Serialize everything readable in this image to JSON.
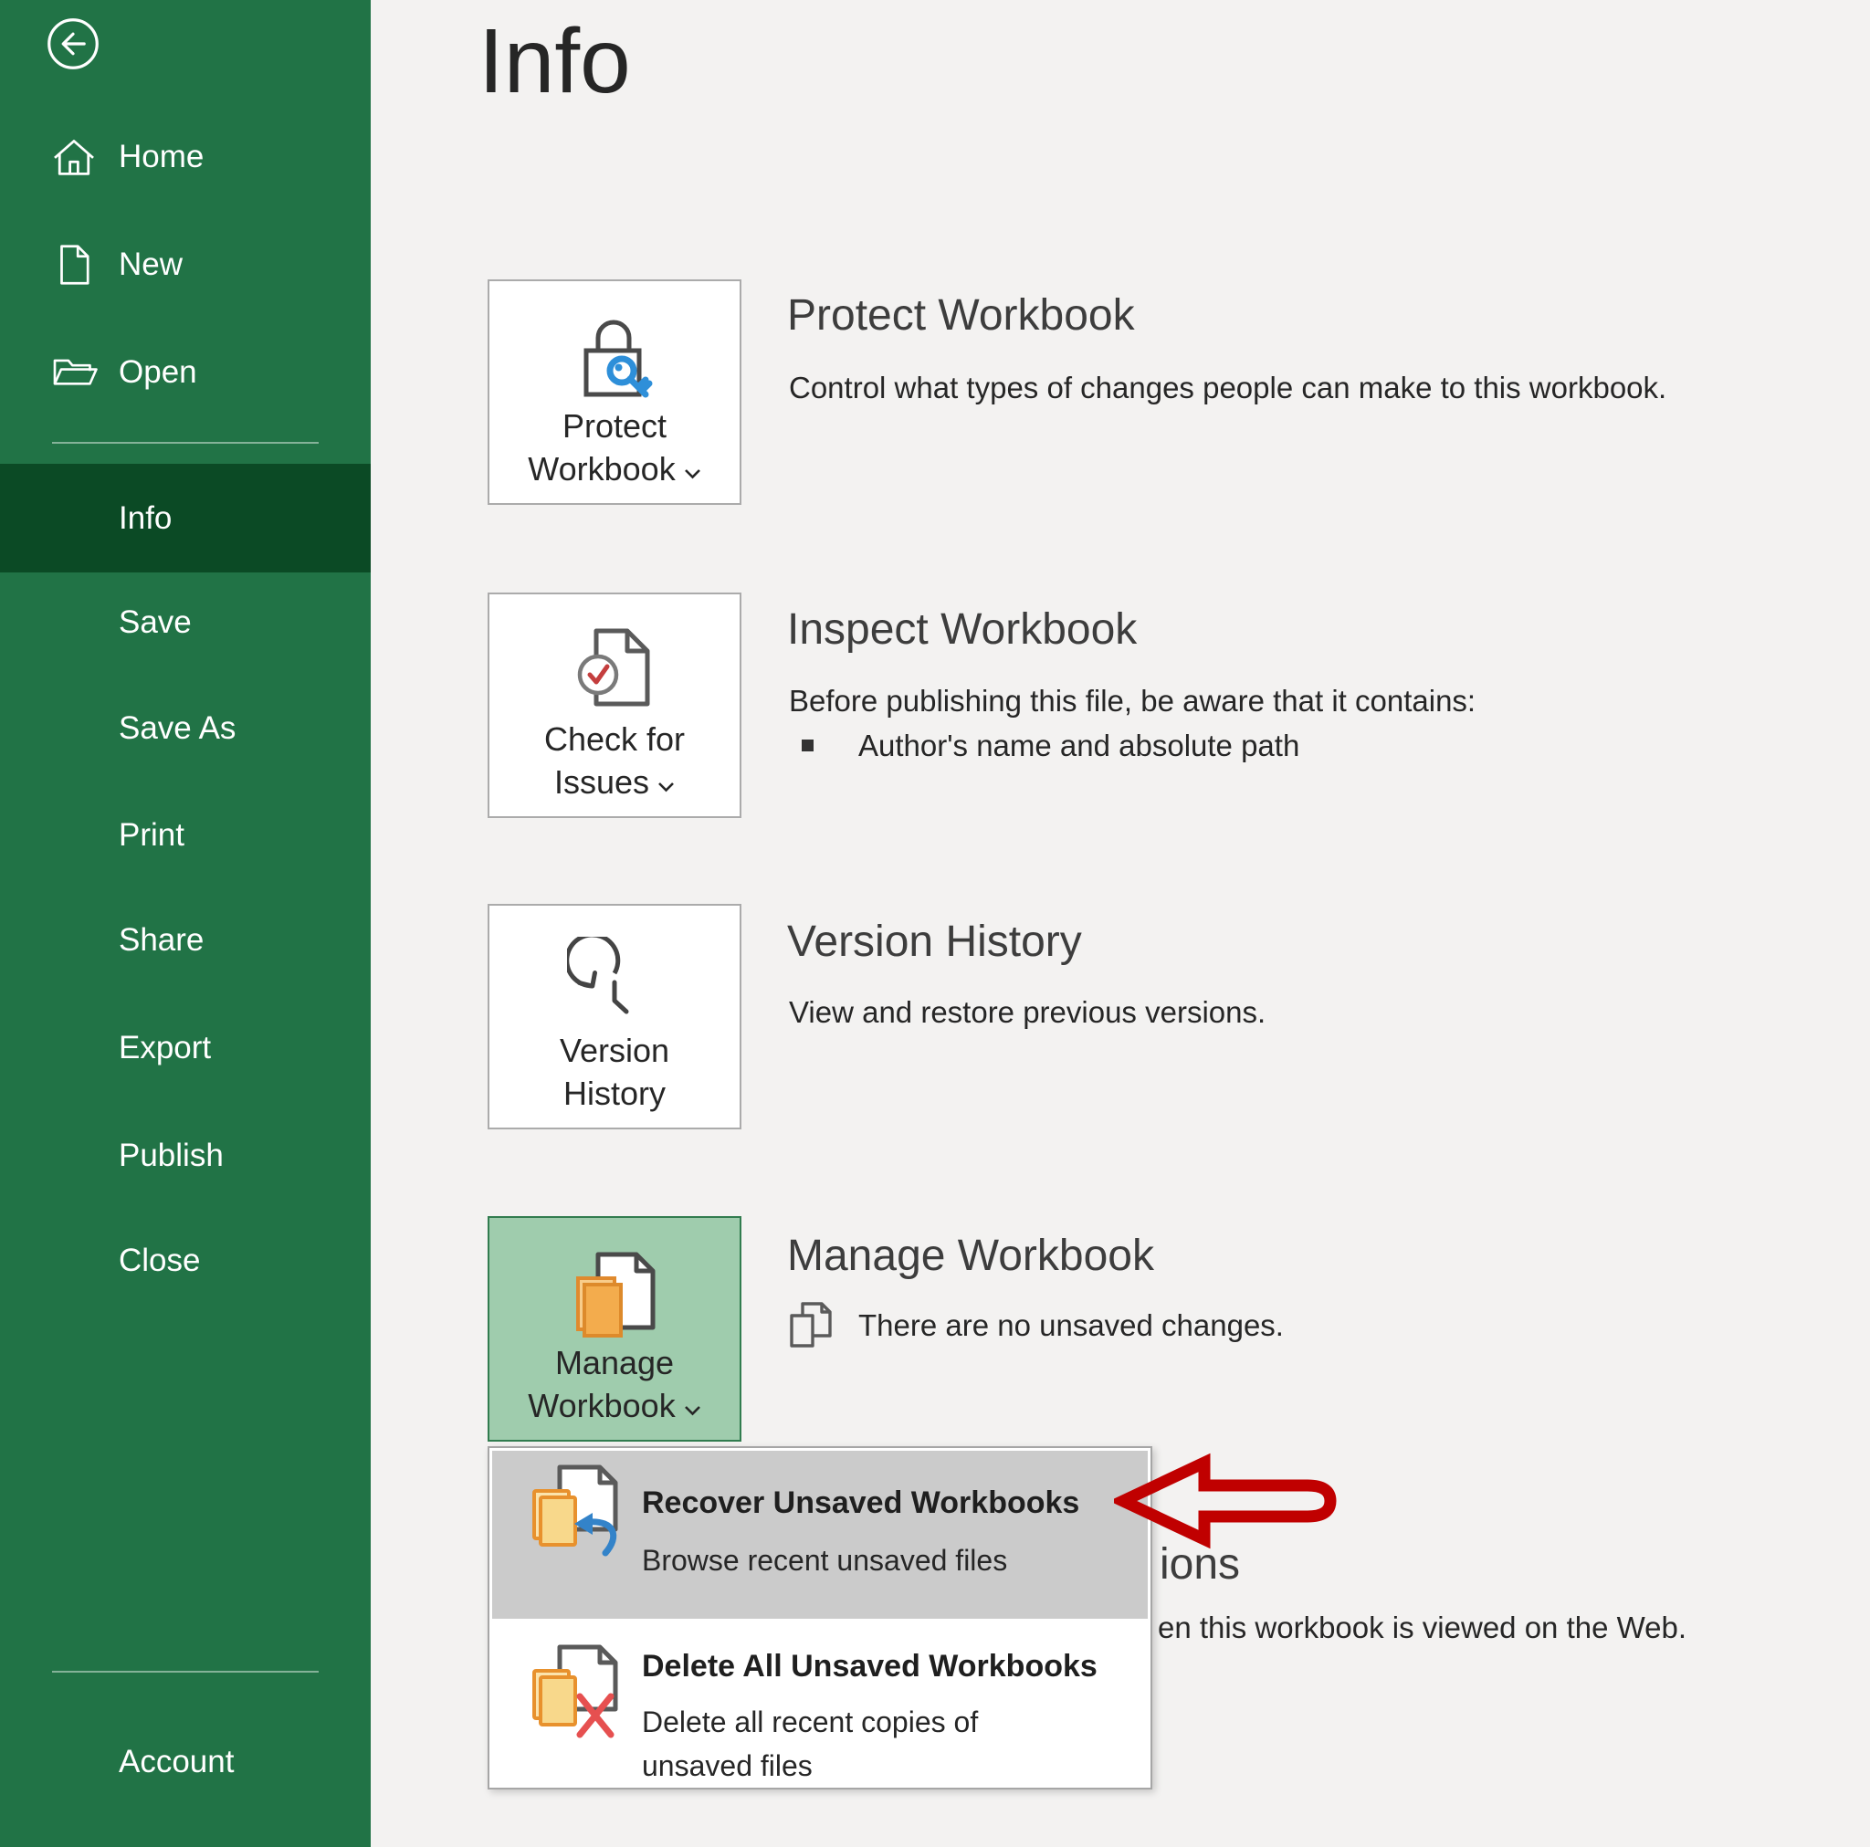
{
  "sidebar": {
    "nav": [
      {
        "label": "Home"
      },
      {
        "label": "New"
      },
      {
        "label": "Open"
      }
    ],
    "menu": [
      {
        "label": "Info",
        "selected": true
      },
      {
        "label": "Save"
      },
      {
        "label": "Save As"
      },
      {
        "label": "Print"
      },
      {
        "label": "Share"
      },
      {
        "label": "Export"
      },
      {
        "label": "Publish"
      },
      {
        "label": "Close"
      }
    ],
    "account": {
      "label": "Account"
    },
    "colors": {
      "background": "#217346",
      "selected_item": "#0b4a25",
      "text": "#ffffff"
    }
  },
  "main": {
    "title": "Info",
    "sections": {
      "protect": {
        "card_label_line1": "Protect",
        "card_label_line2": "Workbook",
        "heading": "Protect Workbook",
        "description": "Control what types of changes people can make to this workbook."
      },
      "inspect": {
        "card_label_line1": "Check for",
        "card_label_line2": "Issues",
        "heading": "Inspect Workbook",
        "description": "Before publishing this file, be aware that it contains:",
        "bullet": "Author's name and absolute path"
      },
      "version": {
        "card_label_line1": "Version",
        "card_label_line2": "History",
        "heading": "Version History",
        "description": "View and restore previous versions."
      },
      "manage": {
        "card_label_line1": "Manage",
        "card_label_line2": "Workbook",
        "heading": "Manage Workbook",
        "status": "There are no unsaved changes."
      }
    },
    "covered_section": {
      "heading_fragment": "ions",
      "description_fragment": "en this workbook is viewed on the Web."
    }
  },
  "dropdown_menu": {
    "items": [
      {
        "title": "Recover Unsaved Workbooks",
        "subtitle": "Browse recent unsaved files",
        "highlighted": true
      },
      {
        "title": "Delete All Unsaved Workbooks",
        "subtitle": "Delete all recent copies of unsaved files",
        "highlighted": false
      }
    ]
  },
  "annotation": {
    "arrow_color": "#c00000"
  },
  "colors": {
    "main_background": "#f3f2f1",
    "card_border": "#ababab",
    "manage_card_background": "#9fccad",
    "manage_card_border": "#317c4f",
    "menu_highlight": "#cbcbcb",
    "heading_text": "#3d3d3d",
    "body_text": "#262626",
    "accent_blue": "#2e8fd9",
    "accent_orange": "#f3ac4d",
    "accent_red": "#d64541"
  }
}
